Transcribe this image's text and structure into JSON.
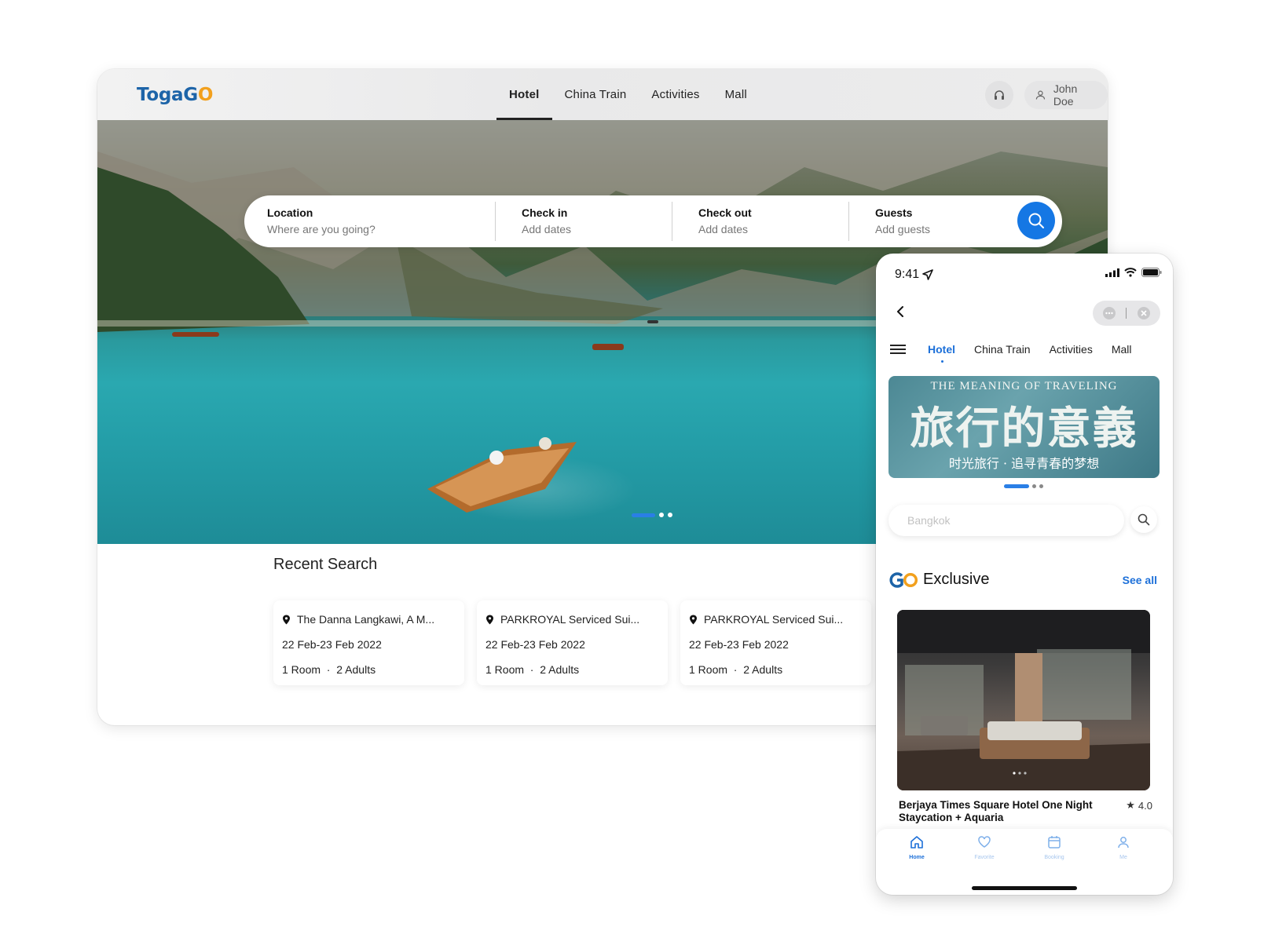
{
  "desktop": {
    "logo": "TogaGO",
    "nav": [
      "Hotel",
      "China Train",
      "Activities",
      "Mall"
    ],
    "user": {
      "name": "John Doe"
    },
    "search": {
      "location": {
        "label": "Location",
        "placeholder": "Where are you going?"
      },
      "checkin": {
        "label": "Check in",
        "placeholder": "Add dates"
      },
      "checkout": {
        "label": "Check out",
        "placeholder": "Add dates"
      },
      "guests": {
        "label": "Guests",
        "placeholder": "Add guests"
      }
    },
    "recent": {
      "title": "Recent Search",
      "cards": [
        {
          "name": "The Danna Langkawi, A M...",
          "dates": "22 Feb-23 Feb 2022",
          "rooms": "1 Room",
          "adults": "2 Adults"
        },
        {
          "name": "PARKROYAL Serviced Sui...",
          "dates": "22 Feb-23 Feb 2022",
          "rooms": "1 Room",
          "adults": "2 Adults"
        },
        {
          "name": "PARKROYAL Serviced Sui...",
          "dates": "22 Feb-23 Feb 2022",
          "rooms": "1 Room",
          "adults": "2 Adults"
        }
      ]
    }
  },
  "phone": {
    "time": "9:41",
    "tabs": [
      "Hotel",
      "China Train",
      "Activities",
      "Mall"
    ],
    "banner": {
      "line1": "THE MEANING OF TRAVELING",
      "line2": "旅行的意義",
      "line3": "时光旅行 · 追寻青春的梦想"
    },
    "search_placeholder": "Bangkok",
    "exclusive": {
      "title": "Exclusive",
      "see_all": "See all"
    },
    "hotel": {
      "name": "Berjaya Times Square Hotel One Night Staycation + Aquaria",
      "rating": "4.0"
    },
    "tabbar": [
      "Home",
      "Favorite",
      "Booking",
      "Me"
    ]
  },
  "colors": {
    "accent": "#1577e4",
    "brand_blue": "#1d64a8",
    "brand_orange": "#f2a01d"
  }
}
